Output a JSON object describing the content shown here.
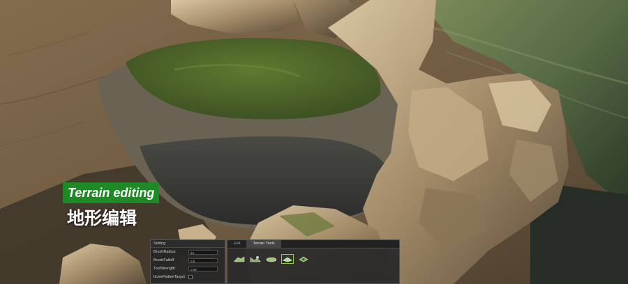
{
  "caption": {
    "title_en": "Terrain editing",
    "title_cn": "地形编辑",
    "badge_color": "#1e8a26"
  },
  "settings_panel": {
    "header": "Setting",
    "properties": [
      {
        "label": "BrushRadius",
        "value": "64"
      },
      {
        "label": "BrushFalloff",
        "value": "0.5"
      },
      {
        "label": "ToolStrength",
        "value": "0.05"
      },
      {
        "label": "bUseFlattenTarget",
        "checked": false
      }
    ]
  },
  "tools_panel": {
    "tabs": [
      {
        "label": "Edit",
        "active": false
      },
      {
        "label": "Terrain Tools",
        "active": true
      }
    ],
    "tools": [
      {
        "icon": "sculpt-raise-icon",
        "selected": false
      },
      {
        "icon": "sculpt-lower-icon",
        "selected": false
      },
      {
        "icon": "smooth-icon",
        "selected": false
      },
      {
        "icon": "flatten-icon",
        "selected": true
      },
      {
        "icon": "paint-icon",
        "selected": false
      }
    ],
    "accent_color": "#8cd13a"
  }
}
